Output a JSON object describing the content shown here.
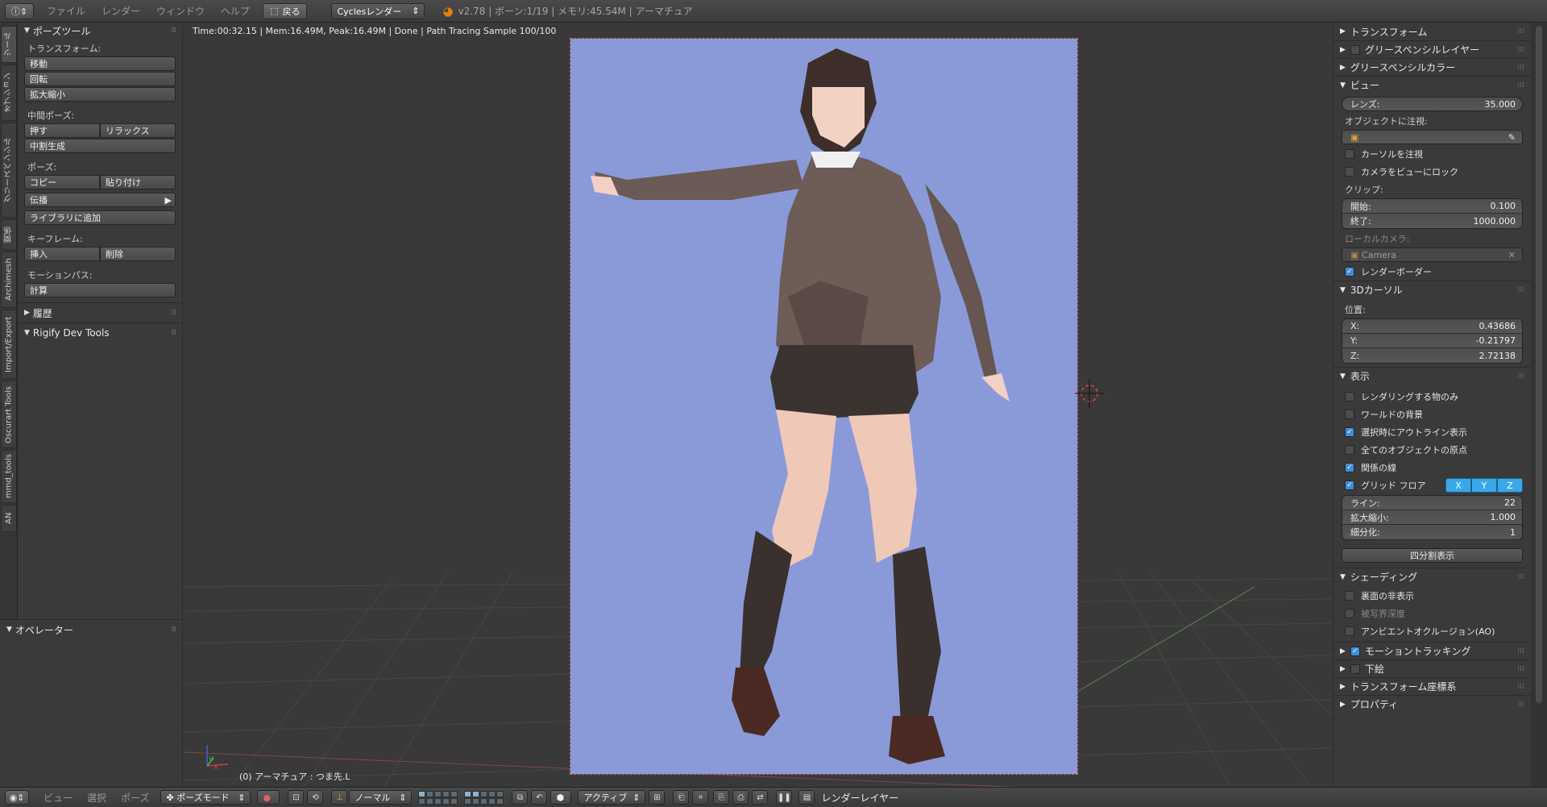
{
  "topbar": {
    "editor_icon": "info-icon",
    "menus": [
      "ファイル",
      "レンダー",
      "ウィンドウ",
      "ヘルプ"
    ],
    "back_label": "戻る",
    "engine": "Cyclesレンダー",
    "stats": "v2.78 | ボーン:1/19 | メモリ:45.54M | アーマチュア"
  },
  "left_tabs": [
    "ツール",
    "オプション",
    "グリースペンシル",
    "関係",
    "Archimesh",
    "Import/Export",
    "Oscurart Tools",
    "mmd_tools",
    "AN"
  ],
  "tool_shelf": {
    "panel_title": "ポーズツール",
    "transform_label": "トランスフォーム:",
    "move": "移動",
    "rotate": "回転",
    "scale": "拡大縮小",
    "inbetween_label": "中間ポーズ:",
    "push": "押す",
    "relax": "リラックス",
    "breakdowner": "中割生成",
    "pose_label": "ポーズ:",
    "copy": "コピー",
    "paste": "貼り付け",
    "propagate": "伝播",
    "add_to_library": "ライブラリに追加",
    "keyframe_label": "キーフレーム:",
    "insert": "挿入",
    "delete": "削除",
    "motion_path_label": "モーションパス:",
    "calculate": "計算",
    "history": "履歴",
    "rigify": "Rigify Dev Tools"
  },
  "operator_panel": {
    "title": "オペレーター"
  },
  "viewport": {
    "render_info": "Time:00:32.15 | Mem:16.49M, Peak:16.49M | Done | Path Tracing Sample 100/100",
    "object_label": "(0) アーマチュア : つま先.L",
    "background_color": "#8a9ad9"
  },
  "properties": {
    "transform": "トランスフォーム",
    "gp_layer": "グリースペンシルレイヤー",
    "gp_color": "グリースペンシルカラー",
    "view": "ビュー",
    "lens_label": "レンズ:",
    "lens_value": "35.000",
    "lock_object_label": "オブジェクトに注視:",
    "lock_cursor": "カーソルを注視",
    "lock_camera": "カメラをビューにロック",
    "clip_label": "クリップ:",
    "clip_start_label": "開始:",
    "clip_start": "0.100",
    "clip_end_label": "終了:",
    "clip_end": "1000.000",
    "local_camera_label": "ローカルカメラ:",
    "local_camera": "Camera",
    "render_border": "レンダーボーダー",
    "cursor_3d": "3Dカーソル",
    "location_label": "位置:",
    "x_label": "X:",
    "x_value": "0.43686",
    "y_label": "Y:",
    "y_value": "-0.21797",
    "z_label": "Z:",
    "z_value": "2.72138",
    "display": "表示",
    "only_render": "レンダリングする物のみ",
    "world_bg": "ワールドの背景",
    "outline_selected": "選択時にアウトライン表示",
    "all_origins": "全てのオブジェクトの原点",
    "relationship_lines": "関係の線",
    "grid_floor": "グリッド フロア",
    "axis_x": "X",
    "axis_y": "Y",
    "axis_z": "Z",
    "lines_label": "ライン:",
    "lines_value": "22",
    "scale_label": "拡大縮小:",
    "scale_value": "1.000",
    "subdiv_label": "細分化:",
    "subdiv_value": "1",
    "quad_view": "四分割表示",
    "shading": "シェーディング",
    "backface": "裏面の非表示",
    "dof": "被写界深度",
    "ao": "アンビエントオクルージョン(AO)",
    "motion_tracking": "モーショントラッキング",
    "background_images": "下絵",
    "transform_orientations": "トランスフォーム座標系",
    "properties_panel": "プロパティ"
  },
  "bottombar": {
    "menus": [
      "ビュー",
      "選択",
      "ポーズ"
    ],
    "mode": "ポーズモード",
    "orientation": "ノーマル",
    "pivot": "アクティブ",
    "render_layer": "レンダーレイヤー"
  }
}
